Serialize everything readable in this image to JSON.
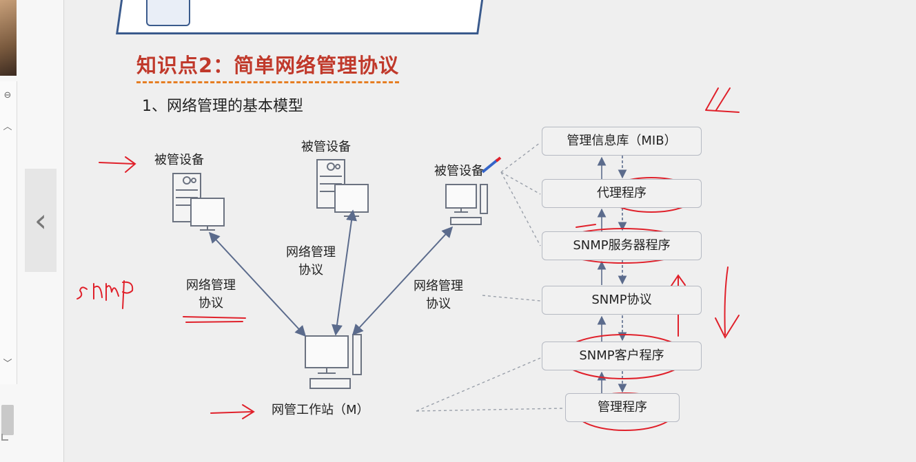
{
  "slide": {
    "knowledge_title": "知识点2：简单网络管理协议",
    "section_title": "1、网络管理的基本模型"
  },
  "diagram": {
    "managed_devices": [
      "被管设备",
      "被管设备",
      "被管设备"
    ],
    "protocol_labels": [
      [
        "网络管理",
        "协议"
      ],
      [
        "网络管理",
        "协议"
      ],
      [
        "网络管理",
        "协议"
      ]
    ],
    "workstation_label": "网管工作站（M）",
    "stack": [
      "管理信息库（MIB）",
      "代理程序",
      "SNMP服务器程序",
      "SNMP协议",
      "SNMP客户程序",
      "管理程序"
    ]
  },
  "annotations": {
    "handwritten": "snmp"
  },
  "colors": {
    "title_red": "#c0392b",
    "dash_orange": "#e67e22",
    "ink_red": "#e0202a",
    "arrow_blue": "#5b6b8c"
  }
}
